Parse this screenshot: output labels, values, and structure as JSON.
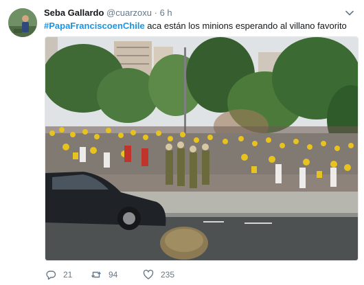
{
  "tweet": {
    "author_name": "Seba Gallardo",
    "handle": "@cuarzoxu",
    "separator": "·",
    "time": "6 h",
    "hashtag": "#PapaFranciscoenChile",
    "text": " aca están los minions esperando al villano favorito",
    "replies": "21",
    "retweets": "94",
    "likes": "235"
  },
  "icons": {
    "reply": "reply-icon",
    "retweet": "retweet-icon",
    "like": "heart-icon",
    "menu": "chevron-down-icon"
  },
  "colors": {
    "link": "#1b95e0",
    "secondary_text": "#657786",
    "primary_text": "#14171a"
  }
}
